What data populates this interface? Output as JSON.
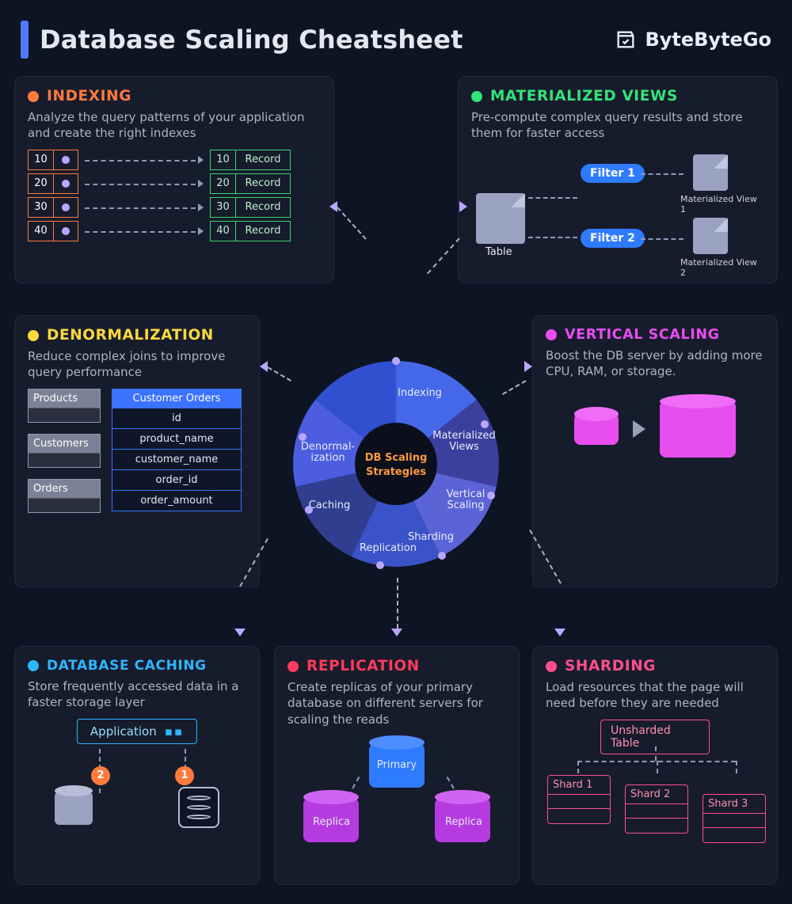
{
  "header": {
    "title": "Database Scaling Cheatsheet",
    "brand": "ByteByteGo"
  },
  "center": {
    "hub_line1": "DB Scaling",
    "hub_line2": "Strategies",
    "segments": {
      "indexing": "Indexing",
      "mat_views_l1": "Materialized",
      "mat_views_l2": "Views",
      "vertical_l1": "Vertical",
      "vertical_l2": "Scaling",
      "sharding": "Sharding",
      "replication": "Replication",
      "caching": "Caching",
      "denorm_l1": "Denormal-",
      "denorm_l2": "ization"
    }
  },
  "panels": {
    "indexing": {
      "title": "INDEXING",
      "desc": "Analyze the query patterns of your application and create the right indexes",
      "left": [
        "10",
        "20",
        "30",
        "40"
      ],
      "right": [
        {
          "k": "10",
          "v": "Record"
        },
        {
          "k": "20",
          "v": "Record"
        },
        {
          "k": "30",
          "v": "Record"
        },
        {
          "k": "40",
          "v": "Record"
        }
      ]
    },
    "mat_views": {
      "title": "MATERIALIZED VIEWS",
      "desc": "Pre-compute complex query results and store them for faster access",
      "table": "Table",
      "filter1": "Filter 1",
      "filter2": "Filter 2",
      "mv1": "Materialized View 1",
      "mv2": "Materialized View 2"
    },
    "denorm": {
      "title": "DENORMALIZATION",
      "desc": "Reduce complex joins to improve query performance",
      "boxes": {
        "products": "Products",
        "customers": "Customers",
        "orders": "Orders"
      },
      "table_hdr": "Customer Orders",
      "rows": [
        "id",
        "product_name",
        "customer_name",
        "order_id",
        "order_amount"
      ]
    },
    "vscaling": {
      "title": "VERTICAL SCALING",
      "desc": "Boost the DB server by adding more CPU, RAM, or storage."
    },
    "caching": {
      "title": "DATABASE CACHING",
      "desc": "Store frequently accessed data in a faster storage layer",
      "app": "Application",
      "badge1": "1",
      "badge2": "2"
    },
    "replication": {
      "title": "REPLICATION",
      "desc": "Create replicas of your primary database on different servers for scaling the reads",
      "primary": "Primary",
      "replica": "Replica"
    },
    "sharding": {
      "title": "SHARDING",
      "desc": "Load resources that the page will need before they are needed",
      "unsharded": "Unsharded Table",
      "shards": [
        "Shard 1",
        "Shard 2",
        "Shard 3"
      ]
    }
  }
}
